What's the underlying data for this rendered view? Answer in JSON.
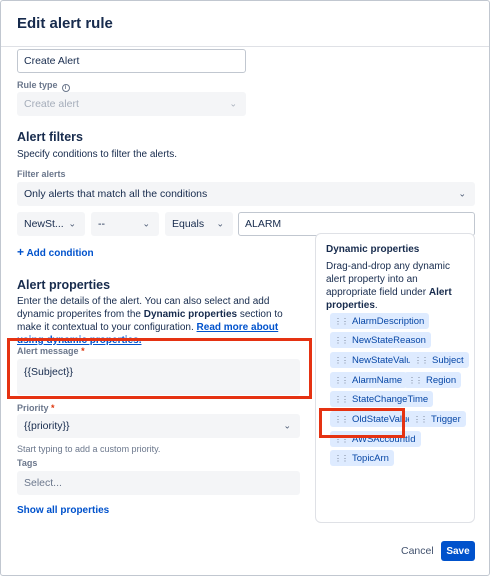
{
  "modal": {
    "title": "Edit alert rule"
  },
  "top_field": {
    "value": "Create Alert"
  },
  "rule_type": {
    "label": "Rule type",
    "value": "Create alert"
  },
  "alert_filters": {
    "heading": "Alert filters",
    "description": "Specify conditions to filter the alerts.",
    "filter_label": "Filter alerts",
    "filter_mode": "Only alerts that match all the conditions",
    "condition": {
      "field": "NewSt...",
      "operator_secondary": "--",
      "operator": "Equals",
      "value": "ALARM"
    },
    "add_condition": "Add condition"
  },
  "alert_properties": {
    "heading": "Alert properties",
    "desc_part1": "Enter the details of the alert. You can also select and add dynamic properites from the ",
    "desc_bold": "Dynamic properties",
    "desc_part2": " section to make it contextual to your configuration. ",
    "desc_link": "Read more about using dynamic properties.",
    "message_label": "Alert message",
    "message_value": "{{Subject}}",
    "priority_label": "Priority",
    "priority_value": "{{priority}}",
    "priority_hint": "Start typing to add a custom priority.",
    "tags_label": "Tags",
    "tags_placeholder": "Select...",
    "show_all": "Show all properties"
  },
  "dynamic_properties": {
    "title": "Dynamic properties",
    "desc_part1": "Drag-and-drop any dynamic alert property into an appropriate field under ",
    "desc_bold": "Alert properties",
    "desc_part2": ".",
    "chips": [
      "AlarmDescription",
      "NewStateReason",
      "NewStateValue",
      "Subject",
      "AlarmName",
      "Region",
      "StateChangeTime",
      "OldStateValue",
      "Trigger",
      "AWSAccountId",
      "TopicArn"
    ]
  },
  "footer": {
    "cancel": "Cancel",
    "save": "Save"
  },
  "colors": {
    "primary": "#0052cc",
    "highlight": "#e53212",
    "chip_bg": "#deebff"
  }
}
